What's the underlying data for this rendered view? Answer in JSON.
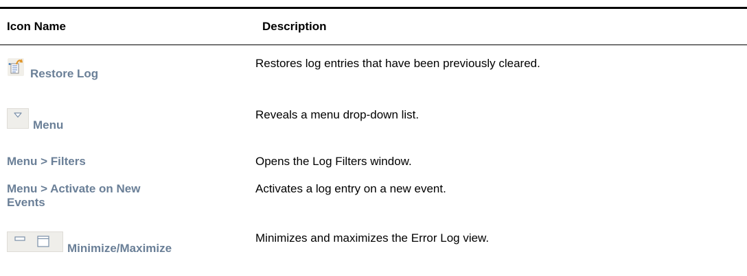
{
  "table": {
    "headers": {
      "icon_name": "Icon Name",
      "description": "Description"
    },
    "rows": [
      {
        "icon": "restore-log-icon",
        "name": "Restore Log",
        "description": "Restores log entries that have been previously cleared."
      },
      {
        "icon": "view-menu-dropdown-icon",
        "name": "Menu",
        "description": "Reveals a menu drop-down list."
      },
      {
        "icon": "",
        "name": "Menu > Filters",
        "description": "Opens the Log Filters window."
      },
      {
        "icon": "",
        "name": "Menu > Activate on New Events",
        "description": "Activates a log entry on a new event."
      },
      {
        "icon": "minimize-maximize-icons",
        "name": "Minimize/Maximize",
        "description": "Minimizes and maximizes the Error Log view."
      }
    ]
  },
  "colors": {
    "command_text": "#6a7f97",
    "rule": "#000000"
  }
}
